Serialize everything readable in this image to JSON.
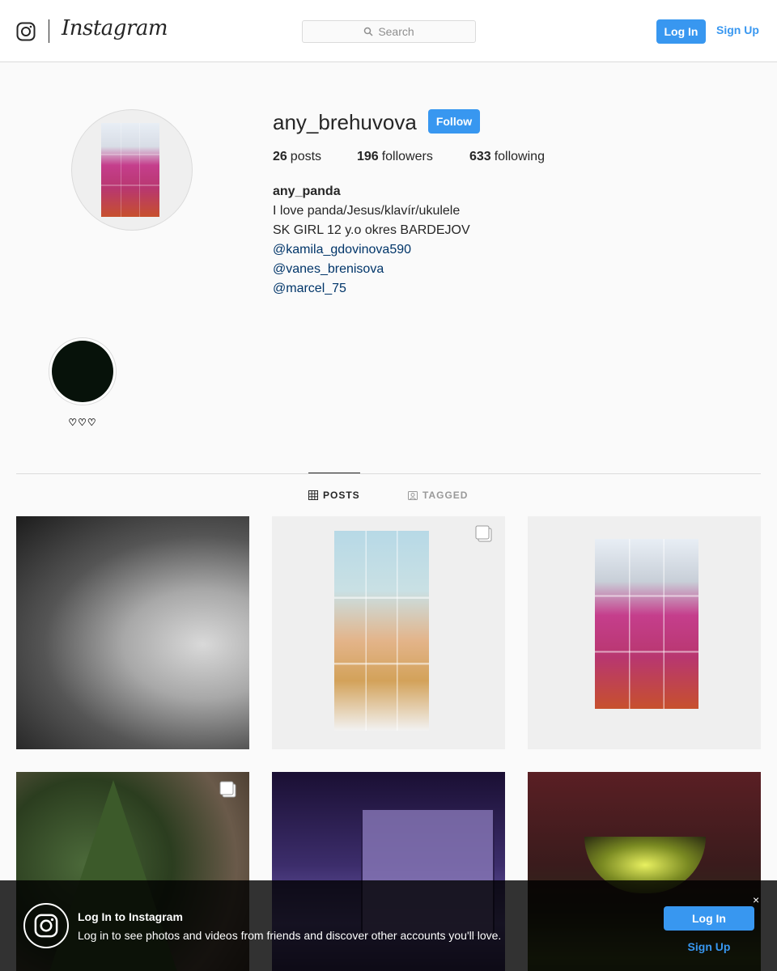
{
  "header": {
    "wordmark": "Instagram",
    "search_placeholder": "Search",
    "login_label": "Log In",
    "signup_label": "Sign Up"
  },
  "profile": {
    "username": "any_brehuvova",
    "follow_label": "Follow",
    "stats": {
      "posts_count": "26",
      "posts_label": "posts",
      "followers_count": "196",
      "followers_label": "followers",
      "following_count": "633",
      "following_label": "following"
    },
    "bio": {
      "full_name": "any_panda",
      "line1": "I love panda/Jesus/klavír/ukulele",
      "line2": "SK GIRL 12 y.o okres BARDEJOV",
      "mentions": [
        "@kamila_gdovinova590",
        "@vanes_brenisova",
        "@marcel_75"
      ]
    }
  },
  "highlights": [
    {
      "label": "♡♡♡"
    }
  ],
  "tabs": [
    {
      "label": "POSTS",
      "icon": "grid-icon",
      "active": true
    },
    {
      "label": "TAGGED",
      "icon": "tag-icon",
      "active": false
    }
  ],
  "posts": [
    {
      "type": "photo"
    },
    {
      "type": "carousel"
    },
    {
      "type": "photo"
    },
    {
      "type": "carousel"
    },
    {
      "type": "photo"
    },
    {
      "type": "photo"
    }
  ],
  "banner": {
    "title": "Log In to Instagram",
    "text": "Log in to see photos and videos from friends and discover other accounts you'll love.",
    "login_label": "Log In",
    "signup_label": "Sign Up",
    "close": "×"
  },
  "colors": {
    "accent": "#3897f0",
    "link": "#003569",
    "border": "#dbdbdb",
    "text": "#262626"
  }
}
